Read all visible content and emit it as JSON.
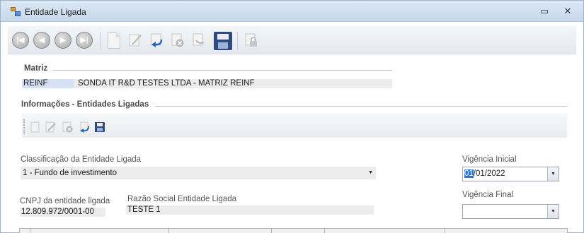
{
  "window": {
    "title": "Entidade Ligada",
    "minimize_glyph": "▭",
    "close_glyph": "✕"
  },
  "toolbar": {
    "icons": [
      "first-record-icon",
      "previous-record-icon",
      "next-record-icon",
      "last-record-icon",
      "new-document-icon",
      "edit-icon",
      "undo-icon",
      "delete-icon",
      "redo-icon",
      "save-icon",
      "lock-icon"
    ]
  },
  "matriz": {
    "section_title": "Matriz",
    "code": "REINF",
    "name": "SONDA IT R&D TESTES LTDA - MATRIZ REINF"
  },
  "entidades": {
    "section_title": "Informações - Entidades Ligadas",
    "toolbar_icons": [
      "new-document-icon",
      "edit-icon",
      "delete-icon",
      "undo-icon",
      "save-icon"
    ]
  },
  "form": {
    "classificacao_label": "Classificação da Entidade Ligada",
    "classificacao_value": "1 - Fundo de investimento",
    "cnpj_label": "CNPJ da entidade ligada",
    "cnpj_value": "12.809.972/0001-00",
    "razao_label": "Razão Social Entidade Ligada",
    "razao_value": "TESTE 1",
    "vigencia_inicial_label": "Vigência Inicial",
    "vigencia_inicial_selected": "01",
    "vigencia_inicial_rest": "/01/2022",
    "vigencia_final_label": "Vigência Final",
    "vigencia_final_value": ""
  },
  "colors": {
    "selection": "#3372c6",
    "code_highlight": "#d6e2f3"
  }
}
